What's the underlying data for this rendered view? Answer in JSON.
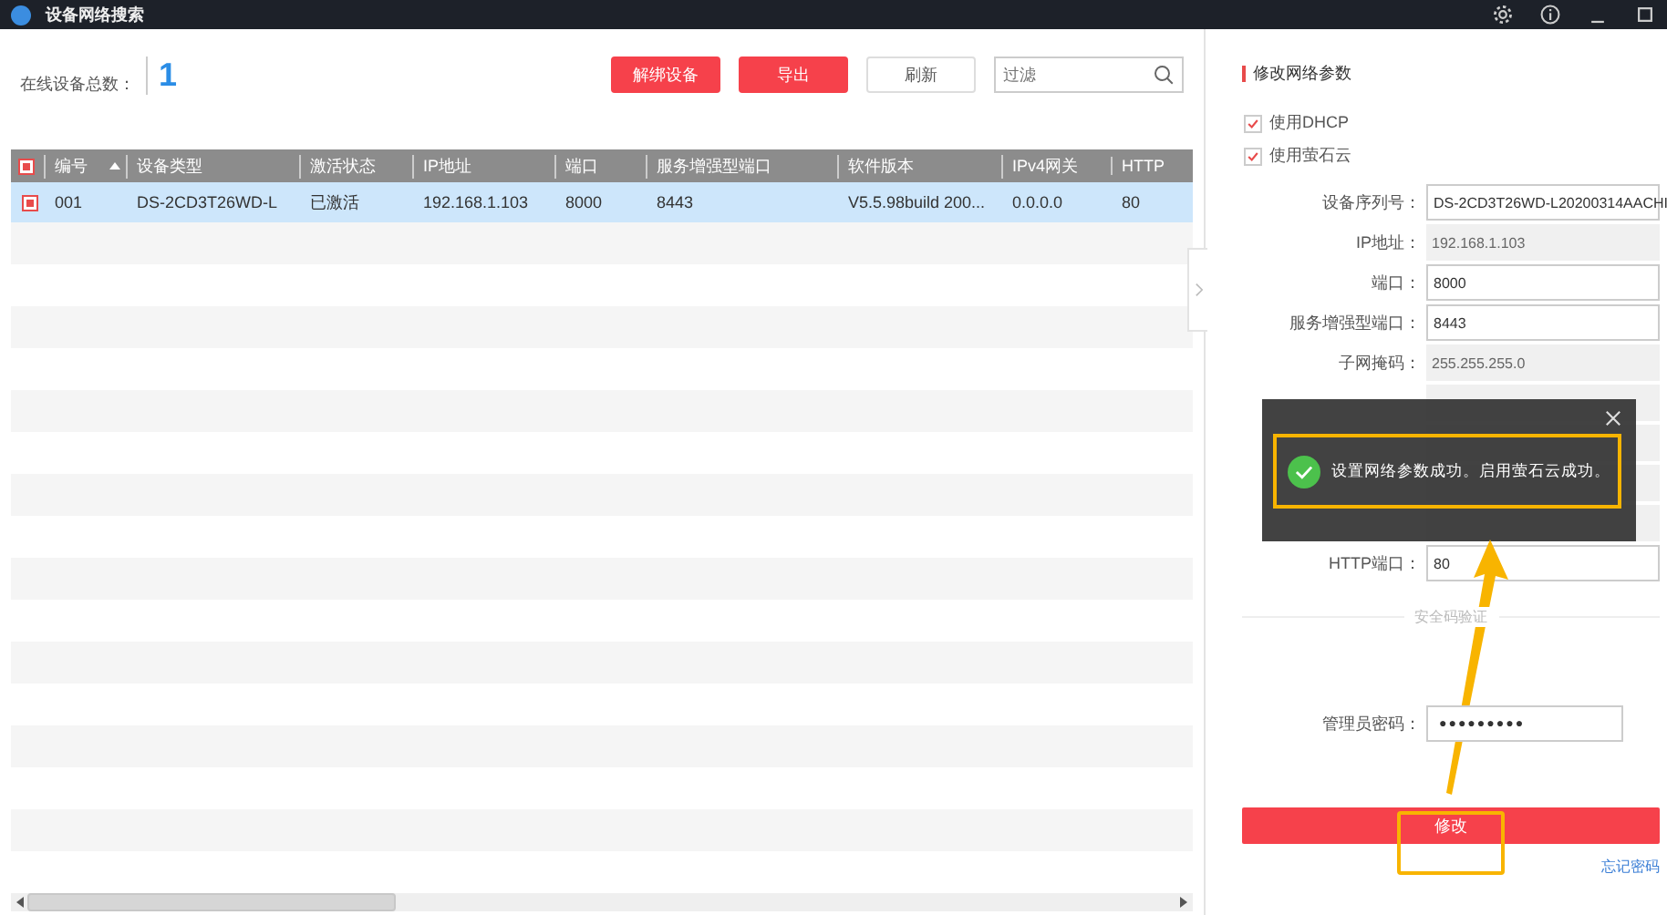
{
  "window": {
    "title": "设备网络搜索"
  },
  "toolbar": {
    "count_label": "在线设备总数：",
    "count": "1",
    "buttons": [
      "解绑设备",
      "导出",
      "刷新"
    ],
    "filter": {
      "placeholder": "过滤"
    }
  },
  "table": {
    "header_checked": true,
    "columns": [
      "编号",
      "设备类型",
      "激活状态",
      "IP地址",
      "端口",
      "服务增强型端口",
      "软件版本",
      "IPv4网关",
      "HTTP"
    ],
    "rows": [
      {
        "checked": true,
        "selected": true,
        "cells": [
          "001",
          "DS-2CD3T26WD-L",
          "已激活",
          "192.168.1.103",
          "8000",
          "8443",
          "V5.5.98build 200...",
          "0.0.0.0",
          "80"
        ]
      }
    ]
  },
  "panel": {
    "title": "修改网络参数",
    "options": [
      {
        "label": "使用DHCP",
        "checked": true
      },
      {
        "label": "使用萤石云",
        "checked": true
      }
    ],
    "fields": [
      {
        "label": "设备序列号：",
        "value": "DS-2CD3T26WD-L20200314AACHI",
        "editable": true
      },
      {
        "label": "IP地址：",
        "value": "192.168.1.103",
        "editable": false
      },
      {
        "label": "端口：",
        "value": "8000",
        "editable": true
      },
      {
        "label": "服务增强型端口：",
        "value": "8443",
        "editable": true
      },
      {
        "label": "子网掩码：",
        "value": "255.255.255.0",
        "editable": false
      }
    ],
    "fields_below": [
      {
        "label": "HTTP端口：",
        "value": "80",
        "editable": true
      }
    ],
    "section": "安全码验证",
    "password": {
      "label": "管理员密码：",
      "value": "●●●●●●●●●"
    },
    "submit": "修改",
    "forgot": "忘记密码"
  },
  "toast": {
    "message": "设置网络参数成功。启用萤石云成功。"
  }
}
